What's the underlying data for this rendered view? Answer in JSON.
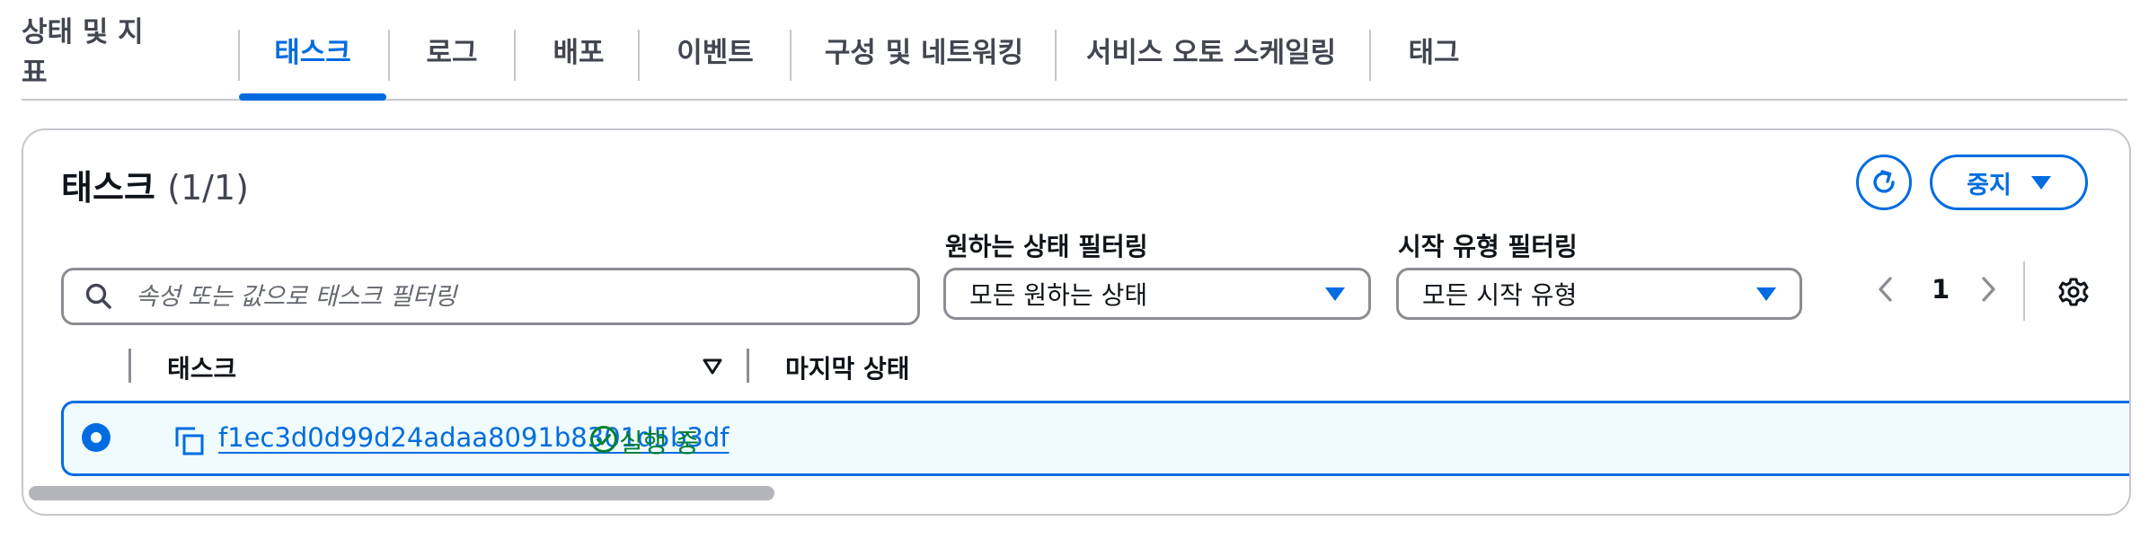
{
  "tabs": [
    {
      "label": "상태 및 지표",
      "active": false
    },
    {
      "label": "태스크",
      "active": true
    },
    {
      "label": "로그",
      "active": false
    },
    {
      "label": "배포",
      "active": false
    },
    {
      "label": "이벤트",
      "active": false
    },
    {
      "label": "구성 및 네트워킹",
      "active": false
    },
    {
      "label": "서비스 오토 스케일링",
      "active": false
    },
    {
      "label": "태그",
      "active": false
    }
  ],
  "panel": {
    "title": "태스크",
    "count": "(1/1)",
    "stop_label": "중지",
    "refresh_icon": "refresh-icon",
    "stop_dropdown_icon": "caret-down-icon"
  },
  "filters": {
    "search_placeholder": "속성 또는 값으로 태스크 필터링",
    "desired_status_label": "원하는 상태 필터링",
    "desired_status_value": "모든 원하는 상태",
    "launch_type_label": "시작 유형 필터링",
    "launch_type_value": "모든 시작 유형"
  },
  "pagination": {
    "current_page": "1"
  },
  "table": {
    "columns": [
      "태스크",
      "마지막 상태"
    ],
    "rows": [
      {
        "task_id": "f1ec3d0d99d24adaa8091b8301d5b3df",
        "last_status": "실행 중",
        "selected": true
      }
    ]
  },
  "colors": {
    "accent": "#006ce0",
    "success": "#00802f",
    "selected_row_bg": "#f0fbff",
    "border": "#8c8c94"
  }
}
